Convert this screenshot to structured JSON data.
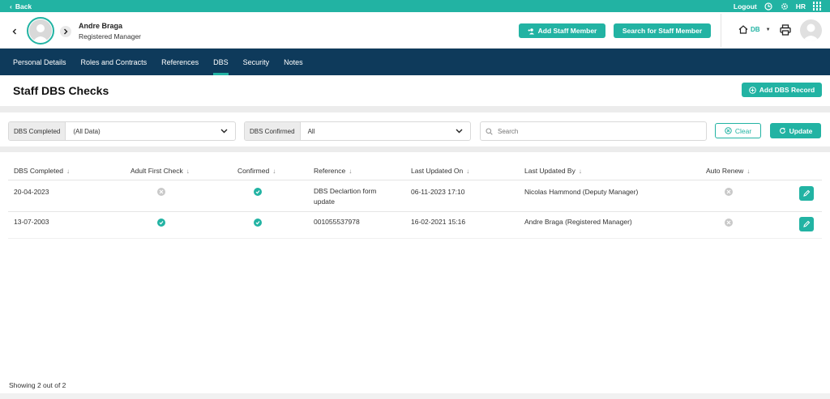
{
  "topbar": {
    "back_label": "Back",
    "logout_label": "Logout",
    "user_initials": "HR"
  },
  "profile": {
    "name": "Andre Braga",
    "role": "Registered Manager"
  },
  "header_buttons": {
    "add_staff": "Add Staff Member",
    "search_staff": "Search for Staff Member"
  },
  "location": {
    "code": "DB"
  },
  "nav": {
    "tabs": [
      "Personal Details",
      "Roles and Contracts",
      "References",
      "DBS",
      "Security",
      "Notes"
    ],
    "active": "DBS"
  },
  "page": {
    "title": "Staff DBS Checks",
    "add_record": "Add DBS Record"
  },
  "filters": {
    "completed_label": "DBS Completed",
    "completed_value": "(All Data)",
    "confirmed_label": "DBS Confirmed",
    "confirmed_value": "All",
    "search_placeholder": "Search",
    "clear_label": "Clear",
    "update_label": "Update"
  },
  "table": {
    "columns": [
      "DBS Completed",
      "Adult First Check",
      "Confirmed",
      "Reference",
      "Last Updated On",
      "Last Updated By",
      "Auto Renew"
    ],
    "rows": [
      {
        "completed": "20-04-2023",
        "adult_first_check": false,
        "confirmed": true,
        "reference_line1": "DBS Declartion form",
        "reference_line2": "update",
        "updated_on": "06-11-2023 17:10",
        "updated_by": "Nicolas Hammond (Deputy Manager)",
        "auto_renew": false
      },
      {
        "completed": "13-07-2003",
        "adult_first_check": true,
        "confirmed": true,
        "reference_line1": "001055537978",
        "reference_line2": "",
        "updated_on": "16-02-2021 15:16",
        "updated_by": "Andre Braga (Registered Manager)",
        "auto_renew": false
      }
    ]
  },
  "footer": {
    "showing": "Showing 2 out of 2"
  },
  "colors": {
    "accent": "#22b3a3",
    "nav": "#0e3a5b",
    "inactive": "#c9c9c9"
  },
  "icons": [
    "chevron-left-icon",
    "chevron-right-icon",
    "logout-icon",
    "gear-icon",
    "apps-grid-icon",
    "user-plus-icon",
    "home-icon",
    "printer-icon",
    "plus-circle-icon",
    "chevron-down-icon",
    "search-icon",
    "clear-icon",
    "refresh-icon",
    "check-icon",
    "cross-icon",
    "pencil-icon"
  ]
}
